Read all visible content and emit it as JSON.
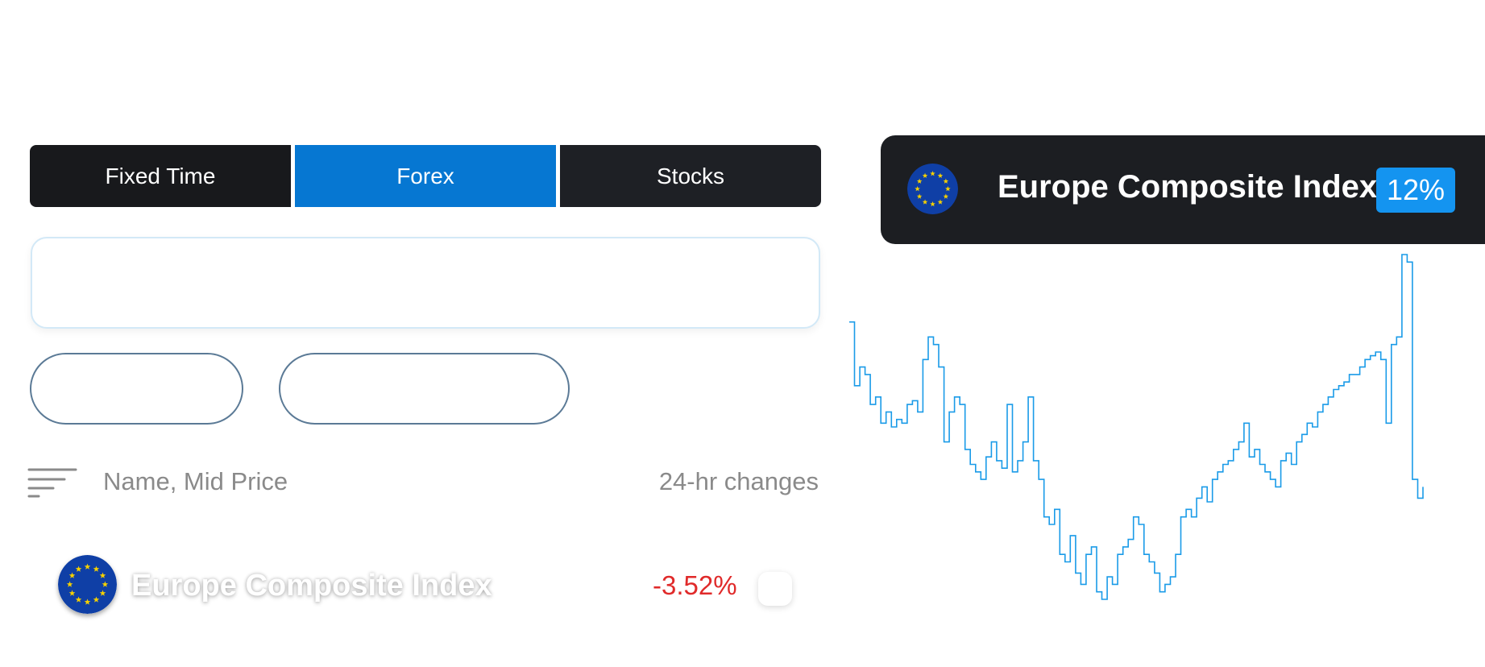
{
  "tabs": [
    {
      "label": "Fixed Time",
      "active": false
    },
    {
      "label": "Forex",
      "active": true
    },
    {
      "label": "Stocks",
      "active": false
    }
  ],
  "search": {
    "value": "",
    "placeholder": ""
  },
  "filters": {
    "pill_1": "",
    "pill_2": ""
  },
  "list_header": {
    "sort_icon": "sort-lines-icon",
    "name_column": "Name, Mid Price",
    "change_column": "24-hr changes"
  },
  "rows": [
    {
      "icon": "eu-flag-icon",
      "name": "Europe Composite Index",
      "change": "-3.52%"
    }
  ],
  "chart_card": {
    "icon": "eu-flag-icon",
    "title": "Europe Composite Index",
    "badge": "12%"
  },
  "colors": {
    "accent": "#0677d2",
    "tab_dark": "#1e2025",
    "negative": "#e02a2a",
    "badge": "#1494f0",
    "line": "#1a9be8",
    "flag_blue": "#0f3fa6",
    "flag_star": "#f5d000"
  },
  "chart_data": {
    "type": "line",
    "title": "",
    "xlabel": "",
    "ylabel": "",
    "series": [
      {
        "values": [
          82,
          65,
          70,
          68,
          60,
          62,
          55,
          58,
          54,
          56,
          55,
          60,
          61,
          58,
          72,
          78,
          76,
          70,
          50,
          58,
          62,
          60,
          48,
          44,
          42,
          40,
          46,
          50,
          45,
          43,
          60,
          42,
          45,
          50,
          62,
          45,
          40,
          30,
          28,
          32,
          20,
          18,
          25,
          15,
          12,
          20,
          22,
          10,
          8,
          14,
          12,
          20,
          22,
          24,
          30,
          28,
          20,
          18,
          15,
          10,
          12,
          14,
          20,
          30,
          32,
          30,
          35,
          38,
          34,
          40,
          42,
          44,
          45,
          48,
          50,
          55,
          46,
          48,
          44,
          42,
          40,
          38,
          45,
          47,
          44,
          50,
          52,
          55,
          54,
          58,
          60,
          62,
          64,
          65,
          66,
          68,
          68,
          70,
          72,
          73,
          74,
          72,
          55,
          76,
          78,
          100,
          98,
          40,
          35,
          38
        ]
      }
    ]
  }
}
